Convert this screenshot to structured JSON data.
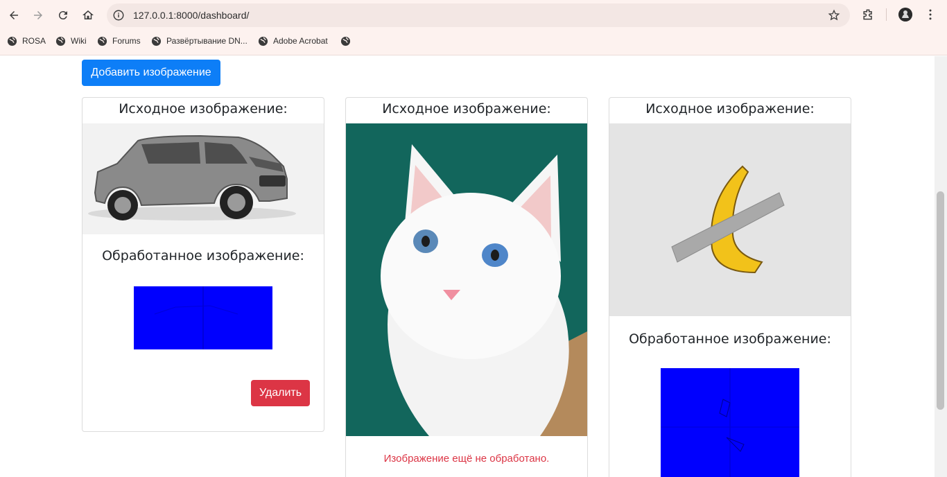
{
  "browser": {
    "url": "127.0.0.1:8000/dashboard/",
    "bookmarks": [
      "ROSA",
      "Wiki",
      "Forums",
      "Развёртывание DN...",
      "Adobe Acrobat",
      ""
    ]
  },
  "page": {
    "add_button": "Добавить изображение",
    "cards": [
      {
        "original_title": "Исходное изображение:",
        "processed_title": "Обработанное изображение:",
        "delete_button": "Удалить"
      },
      {
        "original_title": "Исходное изображение:",
        "not_processed": "Изображение ещё не обработано."
      },
      {
        "original_title": "Исходное изображение:",
        "processed_title": "Обработанное изображение:"
      }
    ]
  },
  "colors": {
    "primary": "#0d7ef7",
    "danger": "#dc3545",
    "processed_fill": "#0000fe"
  }
}
